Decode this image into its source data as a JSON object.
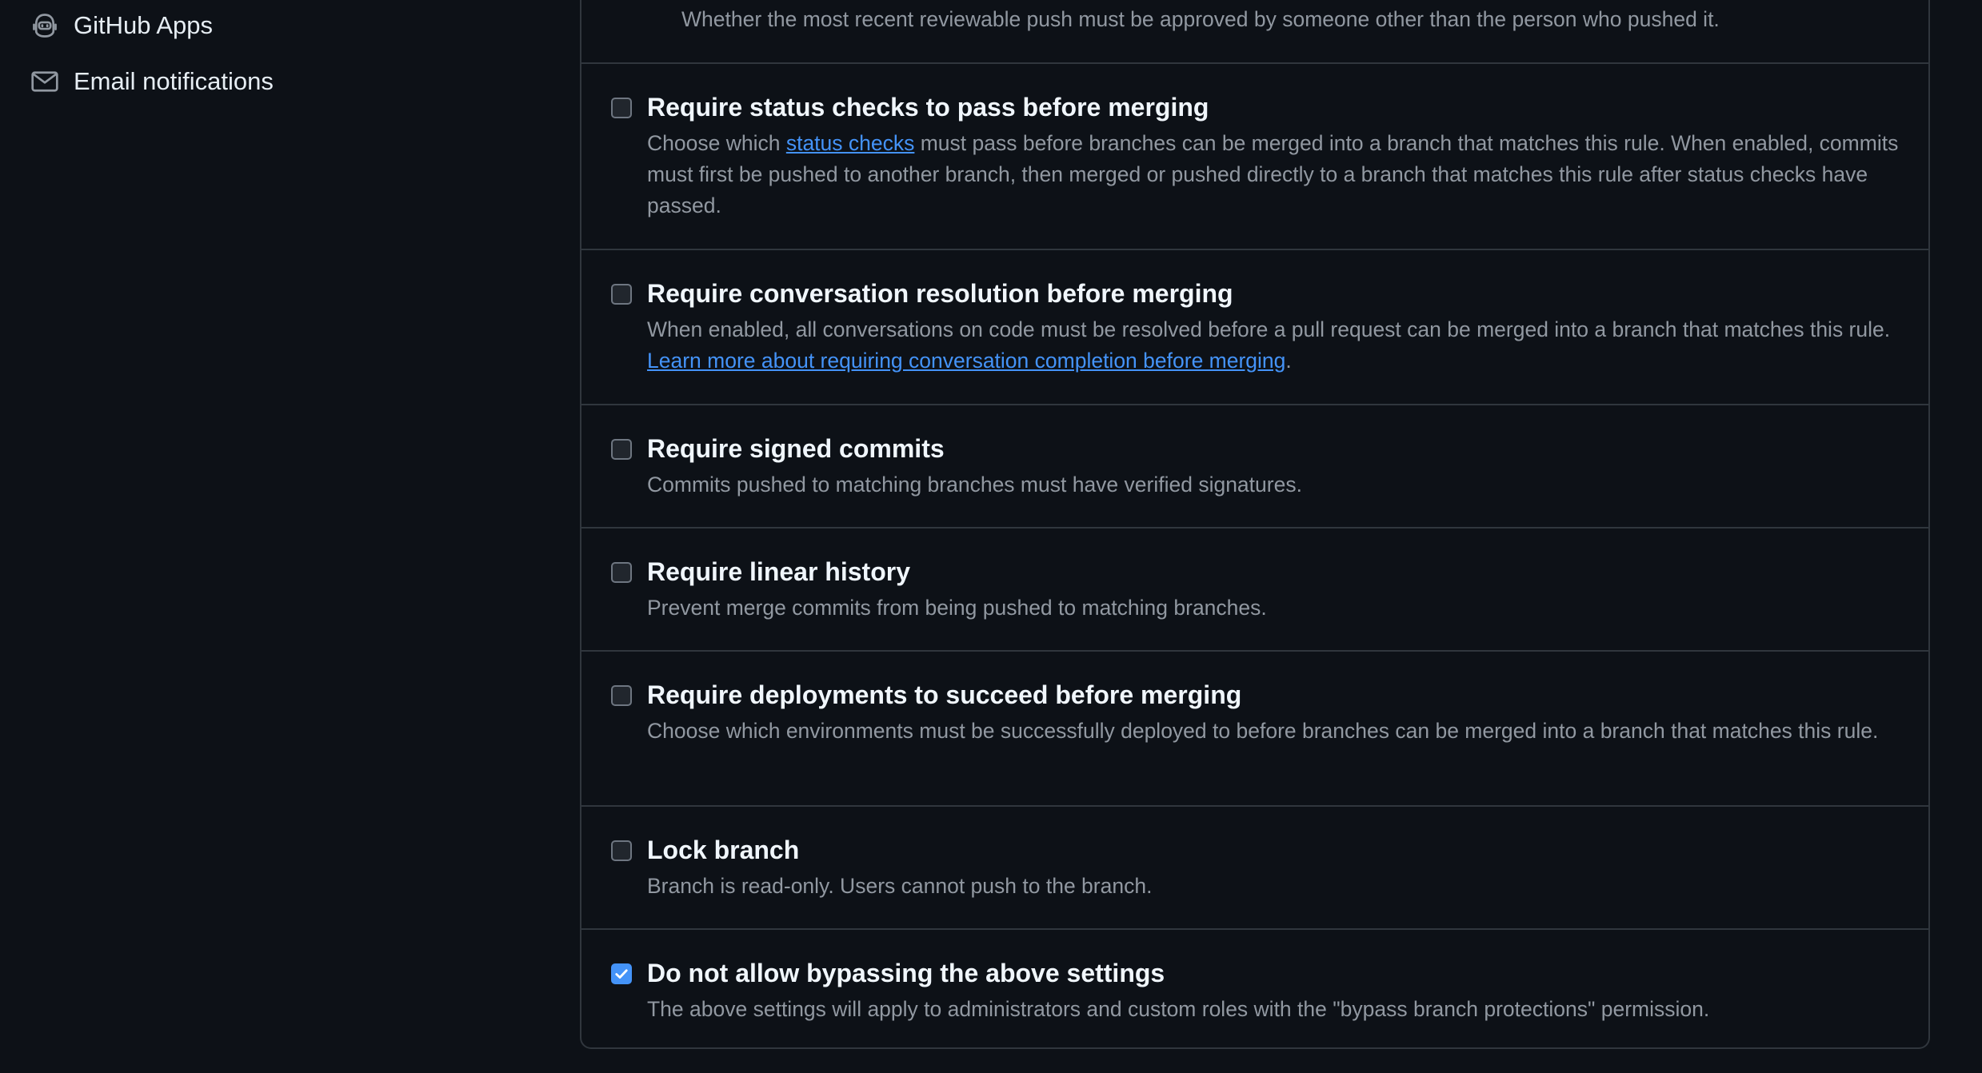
{
  "sidebar": {
    "items": [
      {
        "label": "GitHub Apps",
        "icon": "robot-icon"
      },
      {
        "label": "Email notifications",
        "icon": "mail-icon"
      }
    ]
  },
  "rules": {
    "last_approval_desc": "Whether the most recent reviewable push must be approved by someone other than the person who pushed it.",
    "status_checks": {
      "title": "Require status checks to pass before merging",
      "desc_before": "Choose which ",
      "link": "status checks",
      "desc_after": " must pass before branches can be merged into a branch that matches this rule. When enabled, commits must first be pushed to another branch, then merged or pushed directly to a branch that matches this rule after status checks have passed.",
      "checked": false
    },
    "conversation": {
      "title": "Require conversation resolution before merging",
      "desc_before": "When enabled, all conversations on code must be resolved before a pull request can be merged into a branch that matches this rule. ",
      "link": "Learn more about requiring conversation completion before merging",
      "desc_after": ".",
      "checked": false
    },
    "signed_commits": {
      "title": "Require signed commits",
      "desc": "Commits pushed to matching branches must have verified signatures.",
      "checked": false
    },
    "linear_history": {
      "title": "Require linear history",
      "desc": "Prevent merge commits from being pushed to matching branches.",
      "checked": false
    },
    "deployments": {
      "title": "Require deployments to succeed before merging",
      "desc": "Choose which environments must be successfully deployed to before branches can be merged into a branch that matches this rule.",
      "checked": false
    },
    "lock_branch": {
      "title": "Lock branch",
      "desc": "Branch is read-only. Users cannot push to the branch.",
      "checked": false
    },
    "no_bypass": {
      "title": "Do not allow bypassing the above settings",
      "desc": "The above settings will apply to administrators and custom roles with the \"bypass branch protections\" permission.",
      "checked": true
    }
  },
  "colors": {
    "background": "#0d1117",
    "border": "#30363d",
    "link": "#4493f8",
    "muted_text": "#9198a1",
    "checkbox_checked": "#4493f8"
  }
}
